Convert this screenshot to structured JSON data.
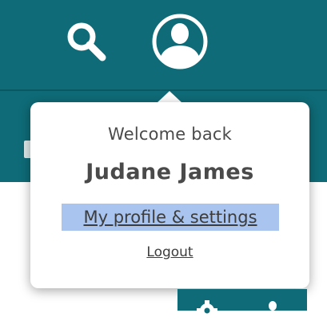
{
  "header": {
    "background_color": "#0e6b77",
    "search_icon": "search-icon",
    "profile_icon": "user-circle-icon"
  },
  "popover": {
    "welcome_text": "Welcome back",
    "user_name": "Judane James",
    "profile_link_label": "My profile & settings",
    "logout_label": "Logout",
    "highlight_color": "#a8c4ef"
  },
  "bottom_toolbar": {
    "icons": [
      "gear-icon",
      "user-icon"
    ]
  }
}
